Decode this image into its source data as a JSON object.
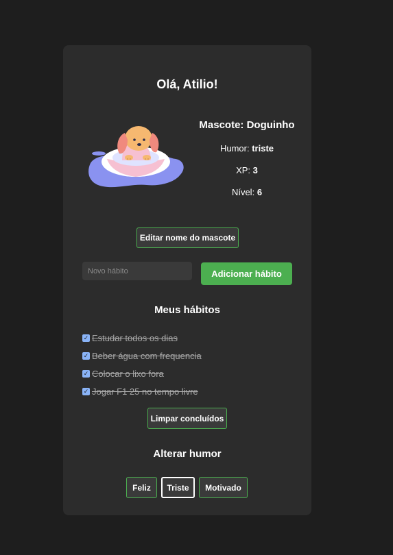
{
  "header": {
    "greeting": "Olá, Atilio!"
  },
  "pet": {
    "title": "Mascote: Doguinho",
    "mood_label": "Humor:",
    "mood_value": "triste",
    "xp_label": "XP:",
    "xp_value": "3",
    "level_label": "Nível:",
    "level_value": "6",
    "edit_button": "Editar nome do mascote"
  },
  "add_habit": {
    "placeholder": "Novo hábito",
    "value": "",
    "button": "Adicionar hábito"
  },
  "habits": {
    "title": "Meus hábitos",
    "items": [
      {
        "label": "Estudar todos os dias",
        "done": true
      },
      {
        "label": "Beber água com frequencia",
        "done": true
      },
      {
        "label": "Colocar o lixo fora",
        "done": true
      },
      {
        "label": "Jogar F1 25 no tempo livre",
        "done": true
      }
    ],
    "clear_button": "Limpar concluídos"
  },
  "mood": {
    "title": "Alterar humor",
    "options": [
      "Feliz",
      "Triste",
      "Motivado"
    ],
    "selected": "Triste"
  },
  "colors": {
    "background": "#1e1e1e",
    "card": "#2c2c2c",
    "accent_green": "#4caf50",
    "checkbox": "#8ab4f8"
  }
}
